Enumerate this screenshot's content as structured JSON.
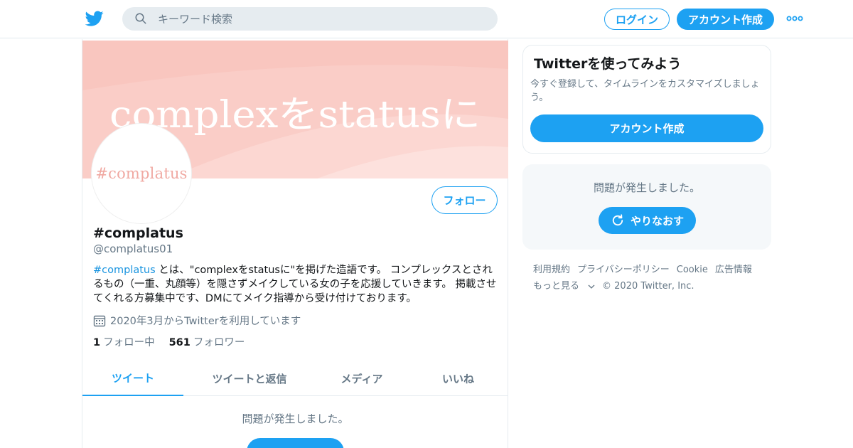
{
  "header": {
    "logo": "twitter-bird-icon",
    "search_placeholder": "キーワード検索",
    "login_label": "ログイン",
    "signup_label": "アカウント作成",
    "more_icon": "more-dots-icon"
  },
  "profile": {
    "banner_text": "complexをstatusに",
    "avatar_text": "#complatus",
    "follow_label": "フォロー",
    "display_name": "#complatus",
    "handle": "@complatus01",
    "bio_hashtag": "#complatus",
    "bio_text": " とは、\"complexをstatusに\"を掲げた造語です。 コンプレックスとされるもの（一重、丸顔等）を隠さずメイクしている女の子を応援していきます。 掲載させてくれる方募集中です、DMにてメイク指導から受け付けております。",
    "joined": "2020年3月からTwitterを利用しています",
    "following_count": "1",
    "following_label": "フォロー中",
    "followers_count": "561",
    "followers_label": "フォロワー"
  },
  "tabs": [
    {
      "label": "ツイート",
      "active": true
    },
    {
      "label": "ツイートと返信",
      "active": false
    },
    {
      "label": "メディア",
      "active": false
    },
    {
      "label": "いいね",
      "active": false
    }
  ],
  "timeline": {
    "error_text": "問題が発生しました。"
  },
  "sidebar": {
    "signup_title": "Twitterを使ってみよう",
    "signup_desc": "今すぐ登録して、タイムラインをカスタマイズしましょう。",
    "signup_button": "アカウント作成",
    "error_text": "問題が発生しました。",
    "retry_label": "やりなおす"
  },
  "footer": {
    "links": [
      "利用規約",
      "プライバシーポリシー",
      "Cookie",
      "広告情報"
    ],
    "more_label": "もっと見る",
    "copyright": "© 2020 Twitter, Inc."
  },
  "colors": {
    "accent": "#1da1f2",
    "banner_bg": "#f9c6bf",
    "text_secondary": "#657786"
  }
}
